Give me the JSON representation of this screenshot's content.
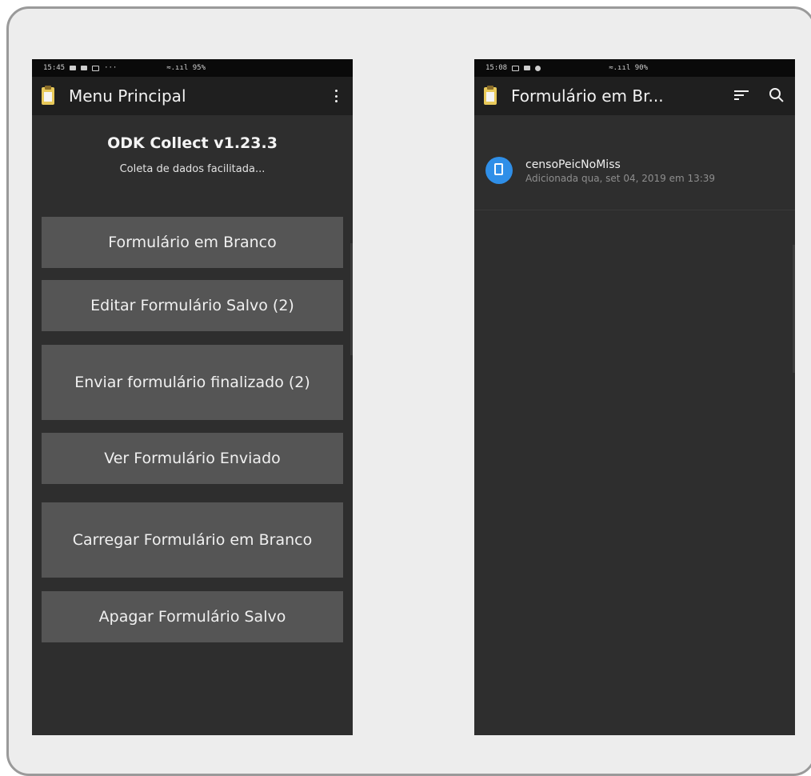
{
  "left_screen": {
    "status": {
      "time": "15:45",
      "signal": "≈.ııl 95%"
    },
    "appbar": {
      "title": "Menu Principal"
    },
    "header": {
      "version": "ODK Collect v1.23.3",
      "tagline": "Coleta de dados facilitada..."
    },
    "menu": [
      {
        "label": "Formulário em Branco"
      },
      {
        "label": "Editar Formulário Salvo (2)"
      },
      {
        "label": "Enviar formulário finalizado (2)"
      },
      {
        "label": "Ver Formulário Enviado"
      },
      {
        "label": "Carregar Formulário em Branco"
      },
      {
        "label": "Apagar Formulário Salvo"
      }
    ]
  },
  "right_screen": {
    "status": {
      "time": "15:08",
      "signal": "≈.ııl 90%"
    },
    "appbar": {
      "title": "Formulário em Br..."
    },
    "forms": [
      {
        "name": "censoPeicNoMiss",
        "date": "Adicionada qua, set 04, 2019 em 13:39"
      }
    ]
  },
  "colors": {
    "accent": "#2f8fe8",
    "button": "#555555",
    "background": "#2e2e2e"
  }
}
